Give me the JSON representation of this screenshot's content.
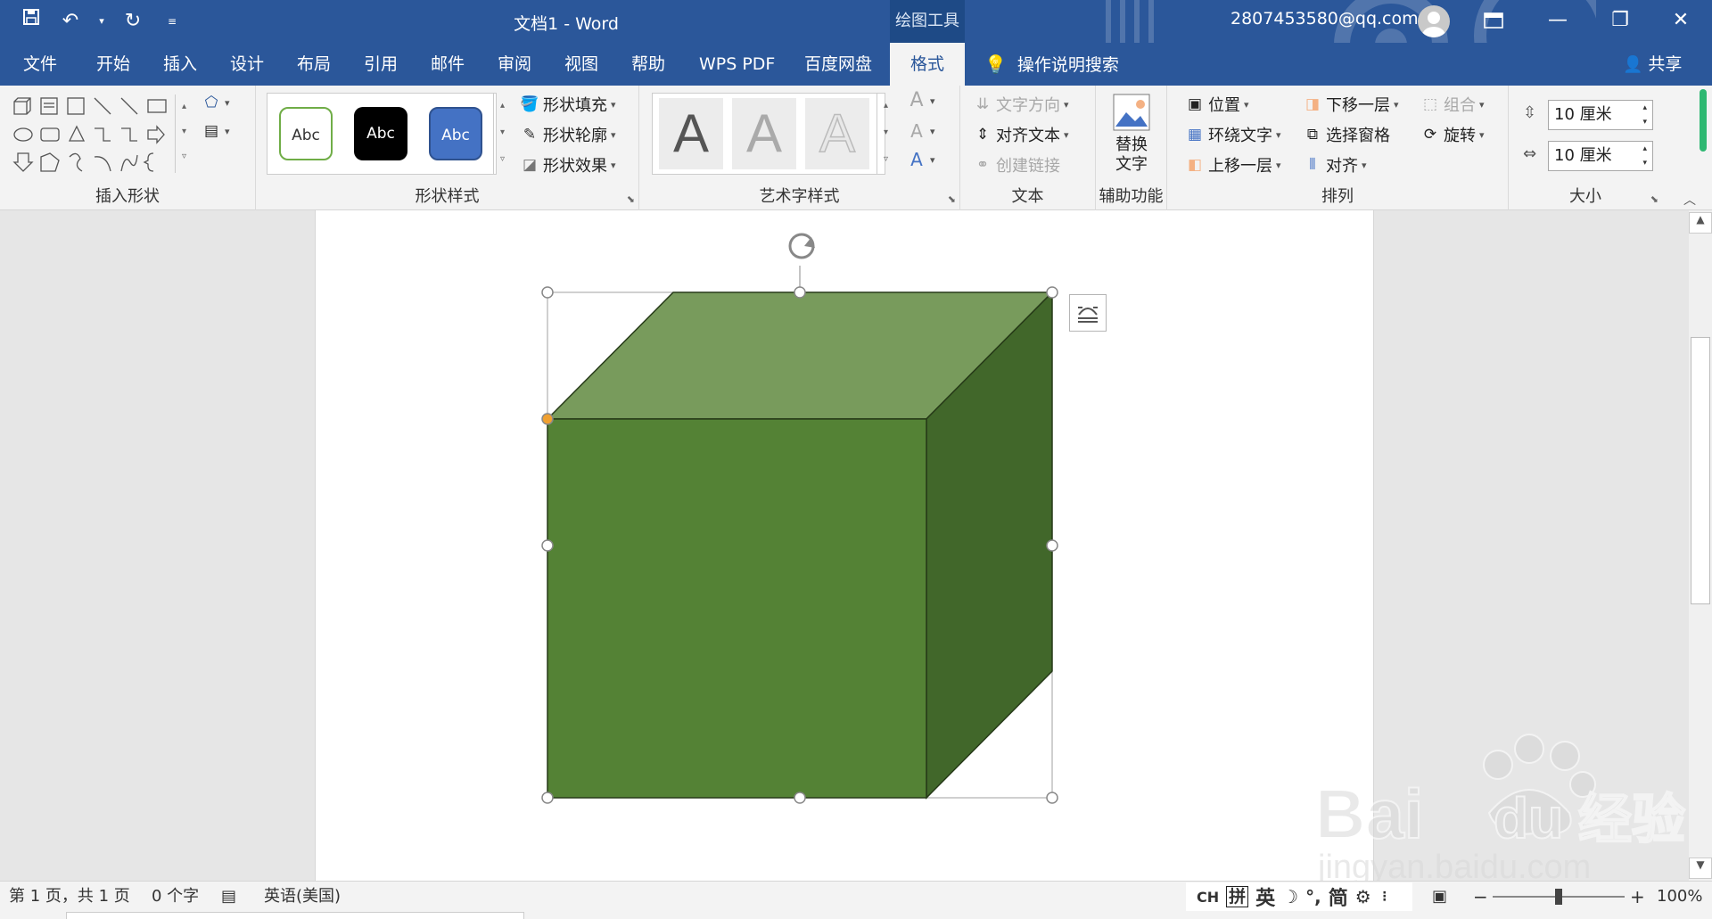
{
  "titlebar": {
    "doc_title": "文档1  -  Word",
    "context_group": "绘图工具",
    "user_email": "2807453580@qq.com"
  },
  "tabs": [
    {
      "label": "文件"
    },
    {
      "label": "开始"
    },
    {
      "label": "插入"
    },
    {
      "label": "设计"
    },
    {
      "label": "布局"
    },
    {
      "label": "引用"
    },
    {
      "label": "邮件"
    },
    {
      "label": "审阅"
    },
    {
      "label": "视图"
    },
    {
      "label": "帮助"
    },
    {
      "label": "WPS PDF"
    },
    {
      "label": "百度网盘"
    },
    {
      "label": "格式"
    }
  ],
  "search_tip": "操作说明搜索",
  "share_label": "共享",
  "ribbon": {
    "insert_shapes": {
      "label": "插入形状"
    },
    "shape_styles": {
      "label": "形状样式",
      "thumb1": "Abc",
      "thumb2": "Abc",
      "thumb3": "Abc",
      "fill": "形状填充",
      "outline": "形状轮廓",
      "effects": "形状效果"
    },
    "wordart": {
      "label": "艺术字样式",
      "glyph": "A"
    },
    "text": {
      "label": "文本",
      "direction": "文字方向",
      "align": "对齐文本",
      "link": "创建链接"
    },
    "accessibility": {
      "label": "辅助功能",
      "alt_text_1": "替换",
      "alt_text_2": "文字"
    },
    "arrange": {
      "label": "排列",
      "position": "位置",
      "wrap": "环绕文字",
      "forward": "上移一层",
      "backward": "下移一层",
      "selection_pane": "选择窗格",
      "align": "对齐",
      "group": "组合",
      "rotate": "旋转"
    },
    "size": {
      "label": "大小",
      "height": "10 厘米",
      "width": "10 厘米"
    }
  },
  "statusbar": {
    "page": "第 1 页，共 1 页",
    "words": "0 个字",
    "language": "英语(美国)",
    "ime": "CH",
    "ime_pin": "拼",
    "ime_en": "英",
    "ime_simple": "简",
    "zoom": "100%"
  },
  "watermark": {
    "text1": "Bai",
    "text2": "du",
    "text3": "经验",
    "text4": "jingyan.baidu.com"
  },
  "colors": {
    "word_blue": "#2b579a",
    "cube_front": "#548235",
    "cube_top": "#789b5c",
    "cube_side": "#41672a"
  }
}
